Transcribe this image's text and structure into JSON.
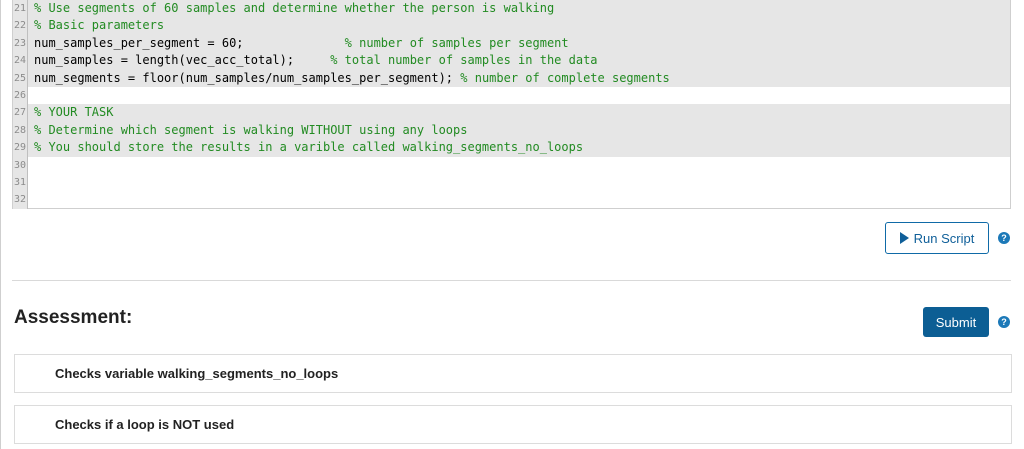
{
  "editor": {
    "lines": [
      {
        "num": "21",
        "code": "",
        "comment": "% Use segments of 60 samples and determine whether the person is walking",
        "shaded": true
      },
      {
        "num": "22",
        "code": "",
        "comment": "% Basic parameters",
        "shaded": true
      },
      {
        "num": "23",
        "code": "num_samples_per_segment = 60;              ",
        "comment": "% number of samples per segment",
        "shaded": true
      },
      {
        "num": "24",
        "code": "num_samples = length(vec_acc_total);     ",
        "comment": "% total number of samples in the data",
        "shaded": true
      },
      {
        "num": "25",
        "code": "num_segments = floor(num_samples/num_samples_per_segment); ",
        "comment": "% number of complete segments",
        "shaded": true
      },
      {
        "num": "26",
        "code": "",
        "comment": "",
        "shaded": false
      },
      {
        "num": "27",
        "code": "",
        "comment": "% YOUR TASK",
        "shaded": true
      },
      {
        "num": "28",
        "code": "",
        "comment": "% Determine which segment is walking WITHOUT using any loops",
        "shaded": true
      },
      {
        "num": "29",
        "code": "",
        "comment": "% You should store the results in a varible called walking_segments_no_loops",
        "shaded": true
      },
      {
        "num": "30",
        "code": "",
        "comment": "",
        "shaded": false
      },
      {
        "num": "31",
        "code": "",
        "comment": "",
        "shaded": false
      },
      {
        "num": "32",
        "code": "",
        "comment": "",
        "shaded": false
      }
    ]
  },
  "toolbar": {
    "run_label": "Run Script",
    "help_symbol": "?"
  },
  "assessment": {
    "title": "Assessment:",
    "submit_label": "Submit",
    "checks": [
      "Checks variable walking_segments_no_loops",
      "Checks if a loop is NOT used"
    ]
  },
  "colors": {
    "accent": "#0c5e94",
    "comment": "#228b22",
    "shaded_line": "#e6e6e6"
  }
}
